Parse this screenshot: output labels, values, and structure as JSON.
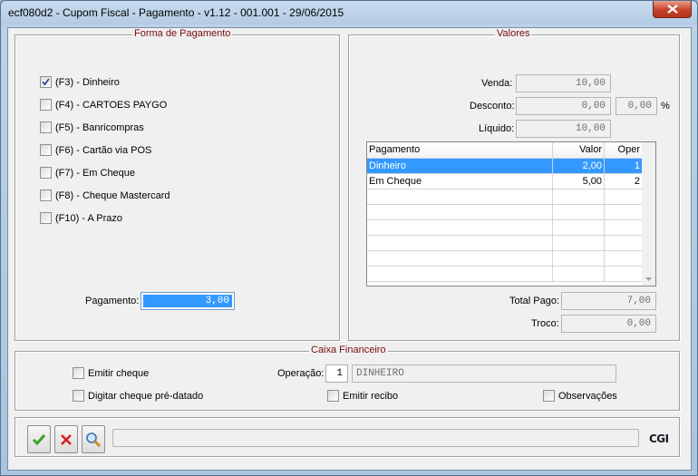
{
  "window": {
    "title": "ecf080d2 - Cupom Fiscal - Pagamento - v1.12 - 001.001 - 29/06/2015",
    "close_symbol": "✕"
  },
  "forma_pagamento": {
    "legend": "Forma de Pagamento",
    "options": [
      {
        "label": "(F3) - Dinheiro",
        "checked": true
      },
      {
        "label": "(F4) - CARTOES PAYGO",
        "checked": false
      },
      {
        "label": "(F5) - Banricompras",
        "checked": false
      },
      {
        "label": "(F6) - Cartão via POS",
        "checked": false
      },
      {
        "label": "(F7) - Em Cheque",
        "checked": false
      },
      {
        "label": "(F8) - Cheque Mastercard",
        "checked": false
      },
      {
        "label": "(F10) - A Prazo",
        "checked": false
      }
    ],
    "pagamento_label": "Pagamento:",
    "pagamento_value": "3,00"
  },
  "valores": {
    "legend": "Valores",
    "venda_label": "Venda:",
    "venda_value": "10,00",
    "desconto_label": "Desconto:",
    "desconto_value": "0,00",
    "desconto_pct_value": "0,00",
    "pct_symbol": "%",
    "liquido_label": "Líquido:",
    "liquido_value": "10,00",
    "grid": {
      "columns": [
        "Pagamento",
        "Valor",
        "Oper"
      ],
      "rows": [
        {
          "pagamento": "Dinheiro",
          "valor": "2,00",
          "oper": "1",
          "selected": true
        },
        {
          "pagamento": "Em Cheque",
          "valor": "5,00",
          "oper": "2",
          "selected": false
        }
      ],
      "empty_rows": 6
    },
    "total_pago_label": "Total Pago:",
    "total_pago_value": "7,00",
    "troco_label": "Troco:",
    "troco_value": "0,00"
  },
  "caixa": {
    "legend": "Caixa Financeiro",
    "emitir_cheque": "Emitir cheque",
    "digitar_cheque": "Digitar cheque pré-datado",
    "operacao_label": "Operação:",
    "operacao_code": "1",
    "operacao_desc": "DINHEIRO",
    "emitir_recibo": "Emitir recibo",
    "observacoes": "Observações"
  },
  "toolbar": {
    "confirm_icon": "check-icon",
    "cancel_icon": "x-icon",
    "search_icon": "magnifier-icon",
    "logo": "CGI"
  }
}
